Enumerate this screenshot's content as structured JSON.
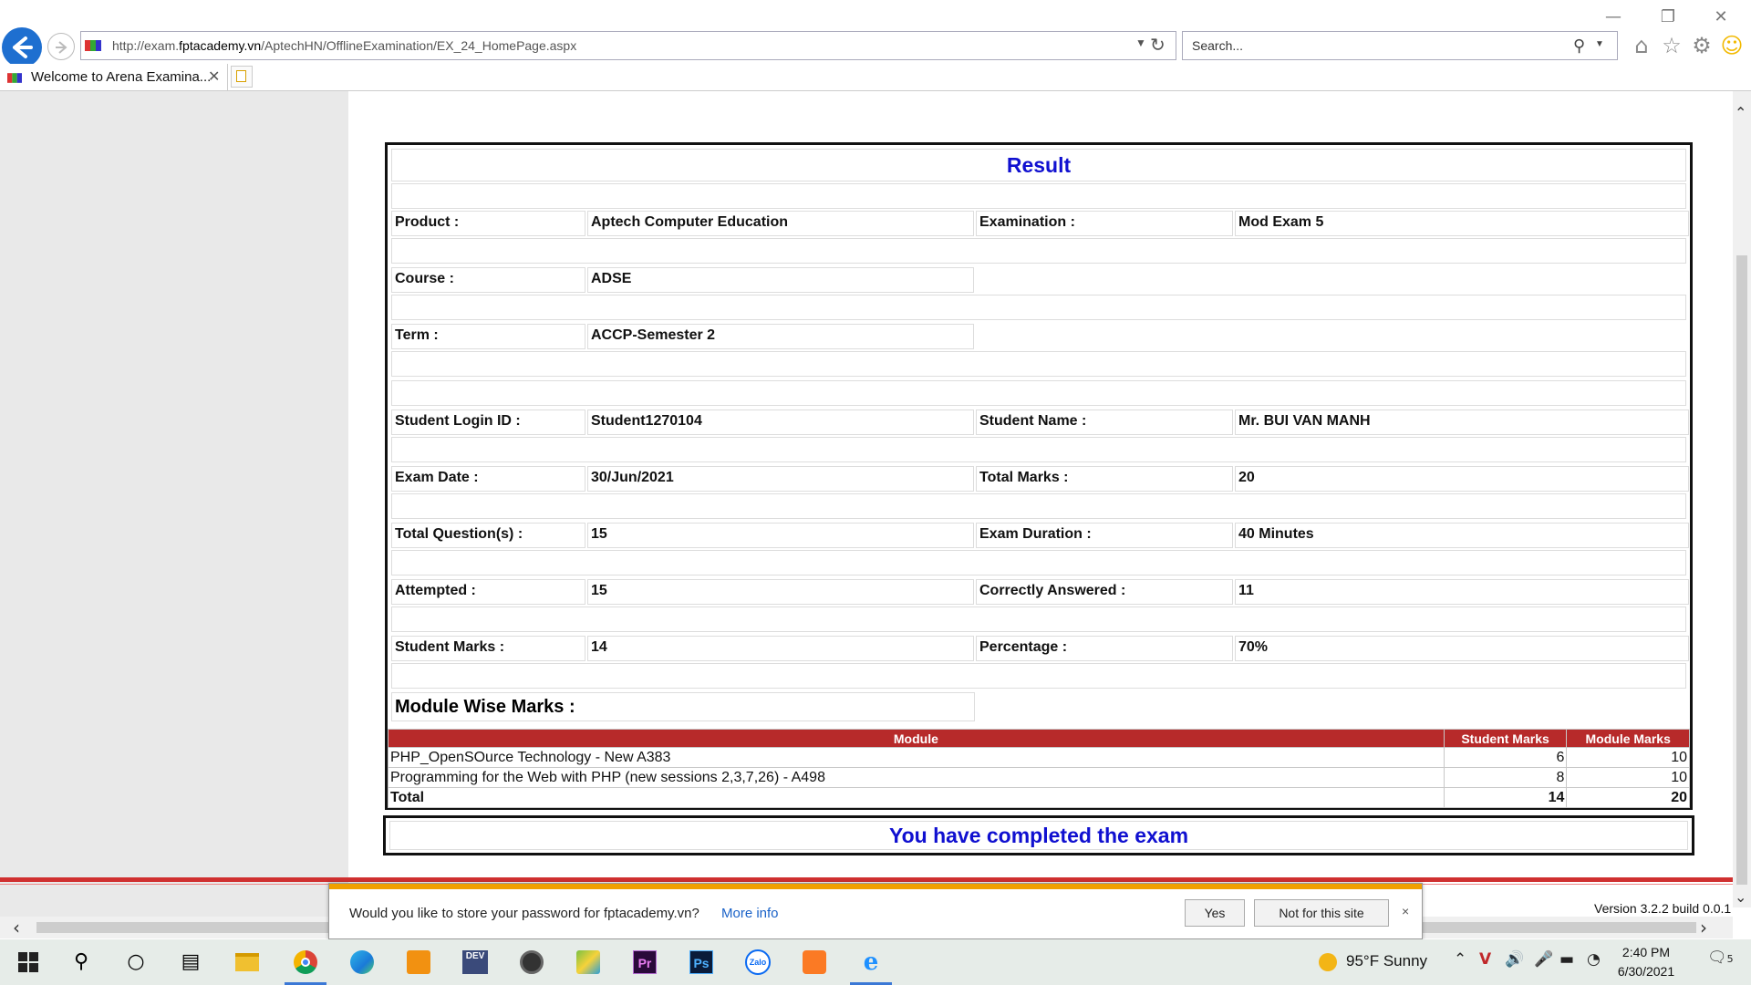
{
  "browser": {
    "url_prefix": "http://exam.",
    "url_domain": "fptacademy.vn",
    "url_path": "/AptechHN/OfflineExamination/EX_24_HomePage.aspx",
    "search_placeholder": "Search...",
    "tab_title": "Welcome to Arena Examina...",
    "window_controls": [
      "—",
      "❐",
      "✕"
    ]
  },
  "result": {
    "title": "Result",
    "fields": [
      {
        "label": "Product :",
        "value": "Aptech Computer Education",
        "label2": "Examination :",
        "value2": "Mod Exam 5"
      },
      {
        "label": "Course :",
        "value": "ADSE"
      },
      {
        "label": "Term :",
        "value": "ACCP-Semester 2"
      },
      {
        "label": "Student Login ID :",
        "value": "Student1270104",
        "label2": "Student Name :",
        "value2": "Mr. BUI VAN MANH"
      },
      {
        "label": "Exam Date :",
        "value": "30/Jun/2021",
        "label2": "Total Marks :",
        "value2": "20"
      },
      {
        "label": "Total Question(s) :",
        "value": "15",
        "label2": "Exam Duration :",
        "value2": "40 Minutes"
      },
      {
        "label": "Attempted :",
        "value": "15",
        "label2": "Correctly Answered :",
        "value2": "11"
      },
      {
        "label": "Student Marks :",
        "value": "14",
        "label2": "Percentage :",
        "value2": "70%"
      }
    ],
    "module_wise_label": "Module Wise Marks :",
    "table": {
      "headers": [
        "Module",
        "Student Marks",
        "Module Marks"
      ],
      "rows": [
        {
          "module": "PHP_OpenSOurce Technology - New A383",
          "student_marks": "6",
          "module_marks": "10"
        },
        {
          "module": "Programming for the Web with PHP (new sessions 2,3,7,26) - A498",
          "student_marks": "8",
          "module_marks": "10"
        }
      ],
      "total": {
        "label": "Total",
        "student_marks": "14",
        "module_marks": "20"
      }
    },
    "completed_message": "You have completed the exam"
  },
  "footer": {
    "version": "Version 3.2.2 build 0.0.1"
  },
  "password_prompt": {
    "question": "Would you like to store your password for fptacademy.vn?",
    "more_info": "More info",
    "yes": "Yes",
    "not_for_site": "Not for this site",
    "close": "×"
  },
  "taskbar": {
    "weather": "95°F  Sunny",
    "time": "2:40 PM",
    "date": "6/30/2021",
    "notification_count": "5"
  },
  "colors": {
    "accent_blue": "#1010d0",
    "table_header": "#b72a2a",
    "prompt_orange": "#f0a000"
  }
}
